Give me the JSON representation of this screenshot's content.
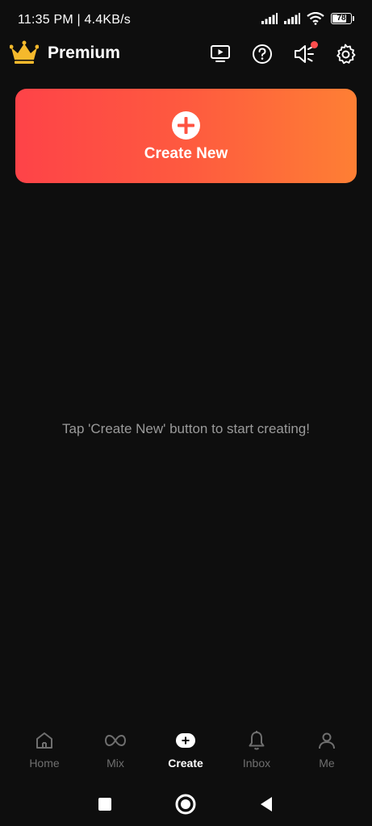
{
  "status_bar": {
    "time_speed": "11:35 PM | 4.4KB/s",
    "battery_level": "78"
  },
  "header": {
    "brand": "Premium",
    "icons": [
      "crown-icon",
      "tv-play-icon",
      "help-icon",
      "speaker-icon",
      "settings-icon"
    ],
    "notification_dot_color": "#ff4d4d"
  },
  "create_card": {
    "label": "Create New",
    "gradient_start": "#fe4348",
    "gradient_end": "#fe7f34"
  },
  "empty_state": {
    "message": "Tap 'Create New' button to start creating!"
  },
  "bottom_nav": {
    "items": [
      {
        "label": "Home",
        "icon": "home-icon"
      },
      {
        "label": "Mix",
        "icon": "infinity-icon"
      },
      {
        "label": "Create",
        "icon": "create-icon",
        "active": true
      },
      {
        "label": "Inbox",
        "icon": "bell-icon"
      },
      {
        "label": "Me",
        "icon": "person-icon"
      }
    ]
  },
  "system_nav": {
    "buttons": [
      "recents-square-icon",
      "home-circle-icon",
      "back-triangle-icon"
    ]
  },
  "colors": {
    "background": "#0e0e0e",
    "accent": "#fe5a3f",
    "inactive": "#6f6f6f",
    "hint": "#9a9a9a"
  }
}
